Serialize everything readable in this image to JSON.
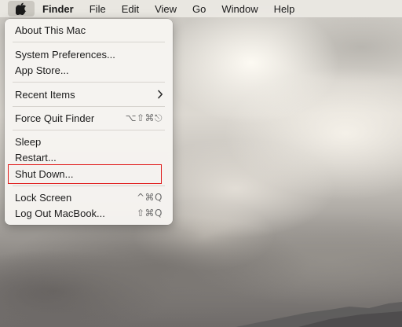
{
  "menubar": {
    "apple_icon": "apple-logo-icon",
    "app_name": "Finder",
    "items": [
      "File",
      "Edit",
      "View",
      "Go",
      "Window",
      "Help"
    ]
  },
  "apple_menu": {
    "items": [
      {
        "label": "About This Mac",
        "shortcut": ""
      },
      {
        "label": "System Preferences...",
        "shortcut": ""
      },
      {
        "label": "App Store...",
        "shortcut": ""
      },
      {
        "label": "Recent Items",
        "shortcut": "",
        "submenu_icon": "chevron-right-icon"
      },
      {
        "label": "Force Quit Finder",
        "shortcut": "⌥⇧⌘⎋"
      },
      {
        "label": "Sleep",
        "shortcut": ""
      },
      {
        "label": "Restart...",
        "shortcut": ""
      },
      {
        "label": "Shut Down...",
        "shortcut": "",
        "annotated": true
      },
      {
        "label": "Lock Screen",
        "shortcut": "^⌘Q"
      },
      {
        "label": "Log Out MacBook...",
        "shortcut": "⇧⌘Q"
      }
    ]
  },
  "colors": {
    "annotation_box": "#e01b1b",
    "menu_background": "#f6f4f1",
    "menubar_background": "#ece9e4"
  }
}
